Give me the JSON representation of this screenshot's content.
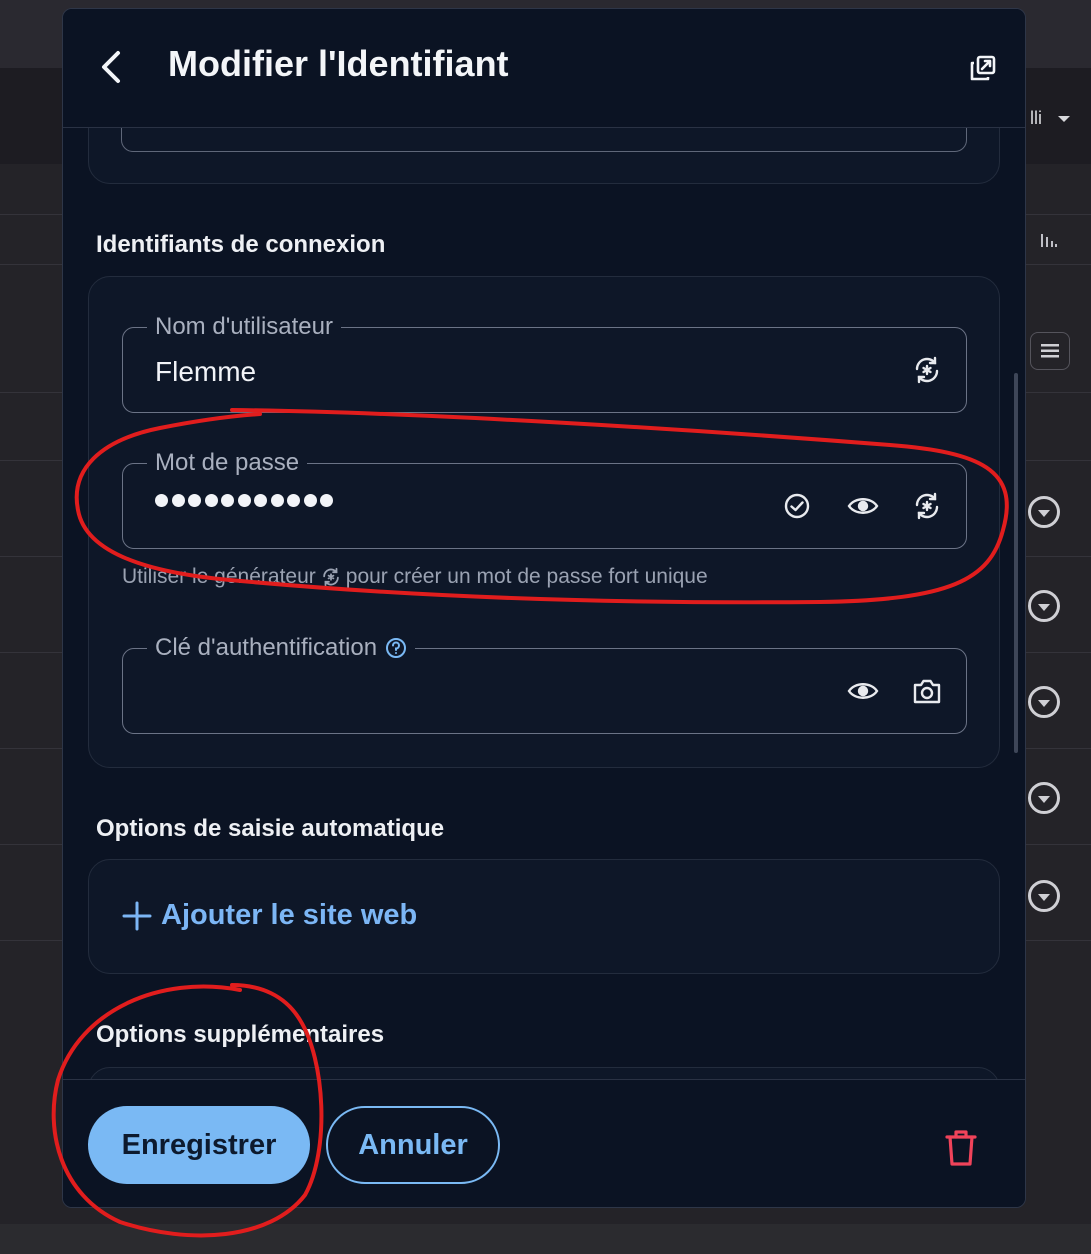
{
  "background": {
    "filter_label": "lli",
    "filter_chevron_icon": "caret-down-icon",
    "chart_icon": "bar-chart-icon",
    "list_icon": "list-icon",
    "row_action_icon": "chevron-circle-down-icon"
  },
  "dialog": {
    "title": "Modifier l'Identifiant",
    "back_icon": "chevron-left-icon",
    "popout_icon": "popout-window-icon"
  },
  "credentials": {
    "section_title": "Identifiants de connexion",
    "username": {
      "label": "Nom d'utilisateur",
      "value": "Flemme",
      "generator_icon": "generator-icon"
    },
    "password": {
      "label": "Mot de passe",
      "masked_length": 11,
      "check_icon": "check-circle-icon",
      "visibility_icon": "eye-icon",
      "generator_icon": "generator-icon"
    },
    "password_hint_before": "Utiliser le générateur",
    "password_hint_after": "pour créer un mot de passe fort unique",
    "auth_key": {
      "label": "Clé d'authentification",
      "help_icon": "help-circle-icon",
      "value": "",
      "visibility_icon": "eye-icon",
      "camera_icon": "camera-icon"
    }
  },
  "autofill": {
    "section_title": "Options de saisie automatique",
    "add_site_label": "Ajouter le site web",
    "add_icon": "plus-icon"
  },
  "additional": {
    "section_title": "Options supplémentaires"
  },
  "footer": {
    "save_label": "Enregistrer",
    "cancel_label": "Annuler",
    "delete_icon": "trash-icon"
  },
  "colors": {
    "accent": "#7ab9f4",
    "danger": "#f0435a",
    "dialog_bg": "#0b1323",
    "annotation": "#e11d1d"
  }
}
